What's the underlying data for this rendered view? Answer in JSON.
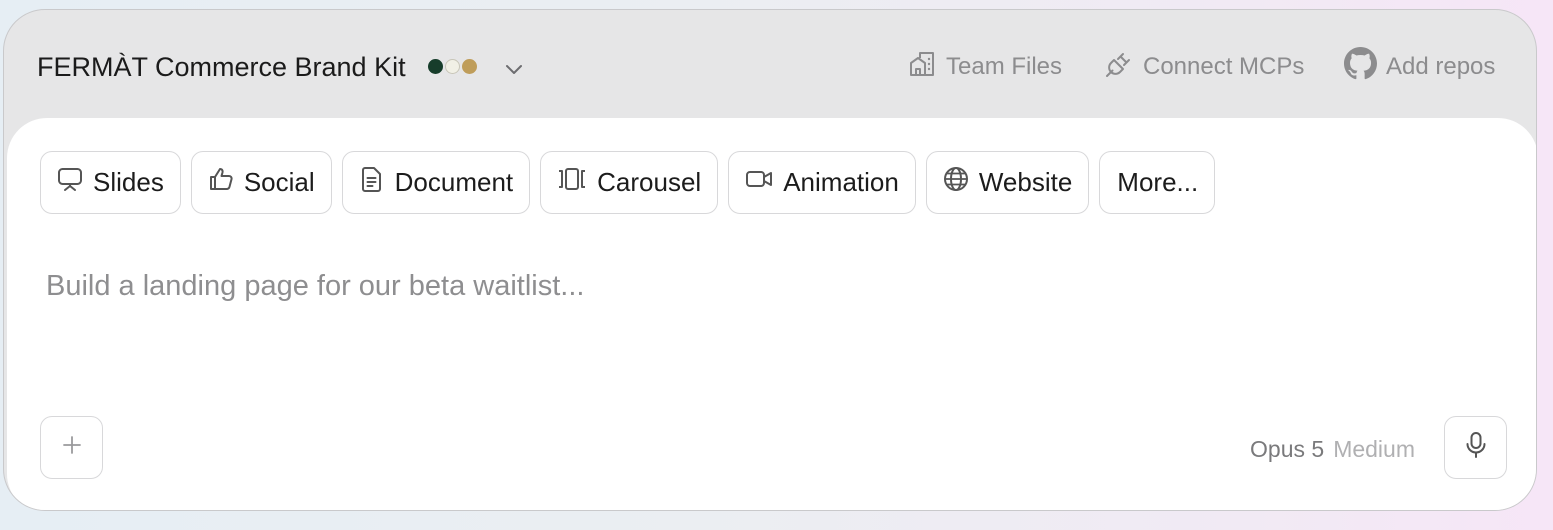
{
  "header": {
    "brand_kit_title": "FERMÀT Commerce Brand Kit",
    "brand_colors": [
      "#173d2b",
      "#f1f0e6",
      "#bf9d5a"
    ],
    "actions": [
      {
        "label": "Team Files",
        "icon": "folder-house-icon"
      },
      {
        "label": "Connect MCPs",
        "icon": "plug-icon"
      },
      {
        "label": "Add repos",
        "icon": "github-icon"
      }
    ]
  },
  "chips": [
    {
      "label": "Slides",
      "icon": "presentation-icon"
    },
    {
      "label": "Social",
      "icon": "thumbs-up-icon"
    },
    {
      "label": "Document",
      "icon": "document-icon"
    },
    {
      "label": "Carousel",
      "icon": "carousel-icon"
    },
    {
      "label": "Animation",
      "icon": "video-camera-icon"
    },
    {
      "label": "Website",
      "icon": "globe-icon"
    },
    {
      "label": "More..."
    }
  ],
  "prompt": {
    "placeholder": "Build a landing page for our beta waitlist...",
    "value": ""
  },
  "footer": {
    "add_icon": "plus-icon",
    "model_name": "Opus 5",
    "model_effort": "Medium",
    "mic_icon": "microphone-icon"
  }
}
